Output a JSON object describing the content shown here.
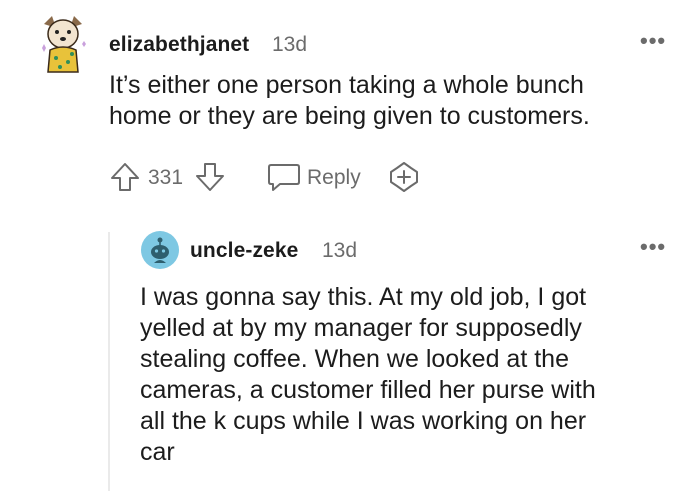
{
  "comment": {
    "username": "elizabethjanet",
    "time": "13d",
    "body_lines": [
      "It’s either one person taking a whole bunch",
      "home or they are being given to customers."
    ],
    "votes": "331",
    "reply_label": "Reply",
    "more_icon": "ellipsis-icon"
  },
  "reply": {
    "username": "uncle-zeke",
    "time": "13d",
    "body_lines": [
      "I was gonna say this. At my old job, I got",
      "yelled at by my manager for supposedly",
      "stealing coffee. When we looked at the",
      "cameras, a customer filled her purse with",
      "all the k cups while I was working on her",
      "car"
    ],
    "more_icon": "ellipsis-icon"
  },
  "colors": {
    "text": "#1c1c1c",
    "meta": "#6b6b6b",
    "avatar_bg": "#7ec8e3",
    "thread_line": "#eaeaea"
  }
}
